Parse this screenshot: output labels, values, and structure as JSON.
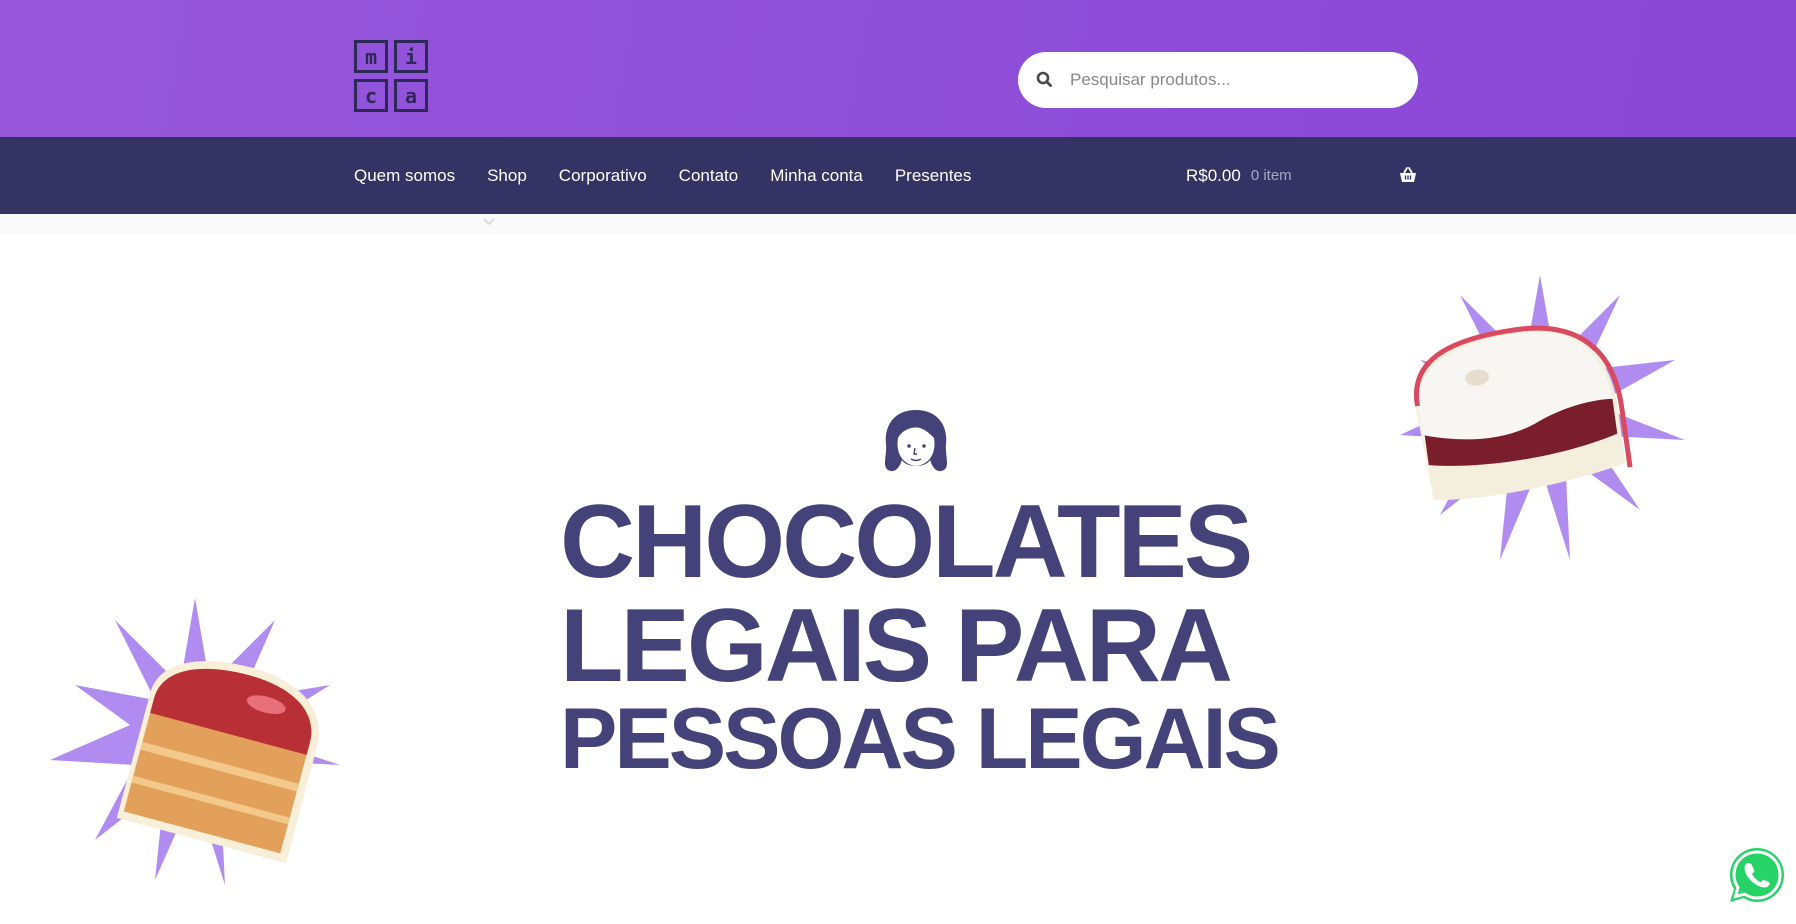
{
  "logo": {
    "letters": [
      "m",
      "i",
      "c",
      "a"
    ]
  },
  "search": {
    "placeholder": "Pesquisar produtos..."
  },
  "nav": {
    "items": [
      {
        "label": "Quem somos"
      },
      {
        "label": "Shop"
      },
      {
        "label": "Corporativo"
      },
      {
        "label": "Contato"
      },
      {
        "label": "Minha conta"
      },
      {
        "label": "Presentes"
      }
    ]
  },
  "cart": {
    "total": "R$0.00",
    "count": "0 item"
  },
  "hero": {
    "line1": "CHOCOLATES",
    "line2": "LEGAIS PARA",
    "line3": "PESSOAS LEGAIS"
  },
  "colors": {
    "header_bg": "#8e4fd8",
    "nav_bg": "#343363",
    "hero_text": "#45427a",
    "star_accent": "#b18cf0",
    "whatsapp": "#25d366"
  },
  "icons": [
    "search-icon",
    "basket-icon",
    "chevron-down-icon",
    "girl-face-icon",
    "whatsapp-icon"
  ]
}
